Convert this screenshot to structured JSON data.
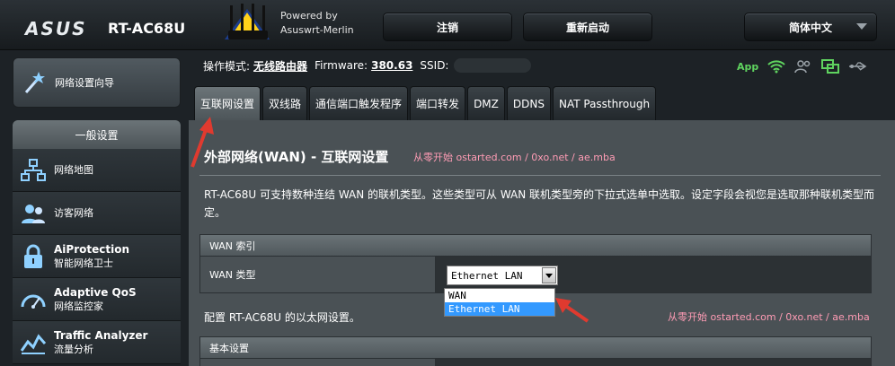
{
  "header": {
    "brand": "ASUS",
    "model": "RT-AC68U",
    "powered_by_line1": "Powered by",
    "powered_by_line2": "Asuswrt-Merlin",
    "logout_label": "注销",
    "reboot_label": "重新启动",
    "language_label": "简体中文"
  },
  "nav": {
    "wizard_label": "网络设置向导",
    "section_title": "一般设置",
    "items": [
      {
        "label": "网络地图",
        "sub": ""
      },
      {
        "label": "访客网络",
        "sub": ""
      },
      {
        "label": "AiProtection",
        "sub": "智能网络卫士"
      },
      {
        "label": "Adaptive QoS",
        "sub": "网络监控家"
      },
      {
        "label": "Traffic Analyzer",
        "sub": "流量分析"
      }
    ]
  },
  "status": {
    "mode_label": "操作模式:",
    "mode_value": "无线路由器",
    "firmware_label": "Firmware:",
    "firmware_value": "380.63",
    "ssid_label": "SSID:",
    "app_label": "App"
  },
  "tabs": [
    "互联网设置",
    "双线路",
    "通信端口触发程序",
    "端口转发",
    "DMZ",
    "DDNS",
    "NAT Passthrough"
  ],
  "main": {
    "title": "外部网络(WAN) - 互联网设置",
    "watermark": "从零开始 ostarted.com / 0xo.net / ae.mba",
    "description": "RT-AC68U 可支持数种连结 WAN 的联机类型。这些类型可从 WAN 联机类型旁的下拉式选单中选取。设定字段会视您是选取那种联机类型而定。",
    "wan_index_header": "WAN 索引",
    "wan_type_label": "WAN 类型",
    "wan_type_value": "Ethernet LAN",
    "wan_type_options": [
      "WAN",
      "Ethernet LAN"
    ],
    "ethernet_note": "配置 RT-AC68U 的以太网设置。",
    "basic_settings_header": "基本设置"
  },
  "colors": {
    "accent_red": "#e03a2f",
    "watermark_pink": "#ff9cb5",
    "app_green": "#5fd35f",
    "selected_blue": "#3399ff"
  }
}
